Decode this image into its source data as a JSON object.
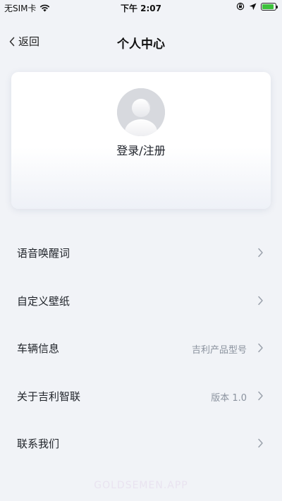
{
  "status_bar": {
    "carrier": "无SIM卡",
    "time": "下午 2:07",
    "icons": [
      "wifi-icon",
      "orientation-lock-icon",
      "location-icon",
      "battery-charging-icon"
    ],
    "battery_level": 0.9,
    "battery_color": "#3cc13b"
  },
  "nav": {
    "back_label": "返回",
    "title": "个人中心"
  },
  "profile": {
    "login_label": "登录/注册",
    "avatar_icon": "default-avatar-icon"
  },
  "menu": {
    "items": [
      {
        "label": "语音唤醒词",
        "value": ""
      },
      {
        "label": "自定义壁纸",
        "value": ""
      },
      {
        "label": "车辆信息",
        "value": "吉利产品型号"
      },
      {
        "label": "关于吉利智联",
        "value": "版本 1.0"
      },
      {
        "label": "联系我们",
        "value": ""
      }
    ]
  },
  "watermark": "GOLDSEMEN.APP",
  "colors": {
    "background": "#f1f3f7",
    "text_primary": "#1f2329",
    "text_secondary": "#8a929e"
  }
}
